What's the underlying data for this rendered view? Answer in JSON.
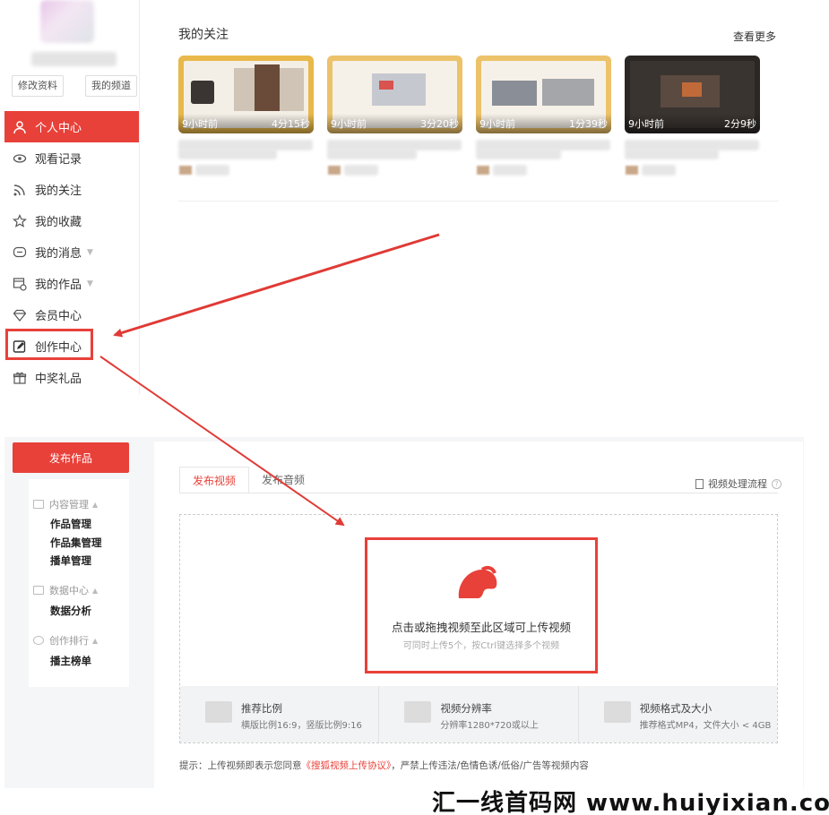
{
  "profile": {
    "edit_label": "修改资料",
    "channel_label": "我的频道"
  },
  "sidebar": {
    "items": [
      {
        "label": "个人中心",
        "icon": "user-icon"
      },
      {
        "label": "观看记录",
        "icon": "eye-icon"
      },
      {
        "label": "我的关注",
        "icon": "rss-icon"
      },
      {
        "label": "我的收藏",
        "icon": "star-icon"
      },
      {
        "label": "我的消息",
        "icon": "message-icon"
      },
      {
        "label": "我的作品",
        "icon": "works-icon"
      },
      {
        "label": "会员中心",
        "icon": "diamond-icon"
      },
      {
        "label": "创作中心",
        "icon": "edit-icon"
      },
      {
        "label": "中奖礼品",
        "icon": "gift-icon"
      }
    ]
  },
  "follow": {
    "title": "我的关注",
    "more_label": "查看更多",
    "videos": [
      {
        "ago": "9小时前",
        "duration": "4分15秒"
      },
      {
        "ago": "9小时前",
        "duration": "3分20秒"
      },
      {
        "ago": "9小时前",
        "duration": "1分39秒"
      },
      {
        "ago": "9小时前",
        "duration": "2分9秒"
      }
    ]
  },
  "creator": {
    "publish_label": "发布作品",
    "menu": {
      "content_group": "内容管理",
      "content_items": [
        "作品管理",
        "作品集管理",
        "播单管理"
      ],
      "data_group": "数据中心",
      "data_items": [
        "数据分析"
      ],
      "rank_group": "创作排行",
      "rank_items": [
        "播主榜单"
      ]
    },
    "tabs": [
      "发布视频",
      "发布音频"
    ],
    "flow_label": "视频处理流程",
    "upload_main": "点击或拖拽视频至此区域可上传视频",
    "upload_sub": "可同时上传5个，按Ctrl键选择多个视频",
    "specs": [
      {
        "title": "推荐比例",
        "desc": "横版比例16:9，竖版比例9:16"
      },
      {
        "title": "视频分辨率",
        "desc": "分辨率1280*720或以上"
      },
      {
        "title": "视频格式及大小",
        "desc": "推荐格式MP4，文件大小 < 4GB"
      }
    ],
    "tip_prefix": "提示：上传视频即表示您同意",
    "tip_link": "《搜狐视频上传协议》",
    "tip_suffix": "，严禁上传违法/色情色诱/低俗/广告等视频内容"
  },
  "watermark": "汇一线首码网 www.huiyixian.com",
  "colors": {
    "accent": "#e8413a"
  }
}
